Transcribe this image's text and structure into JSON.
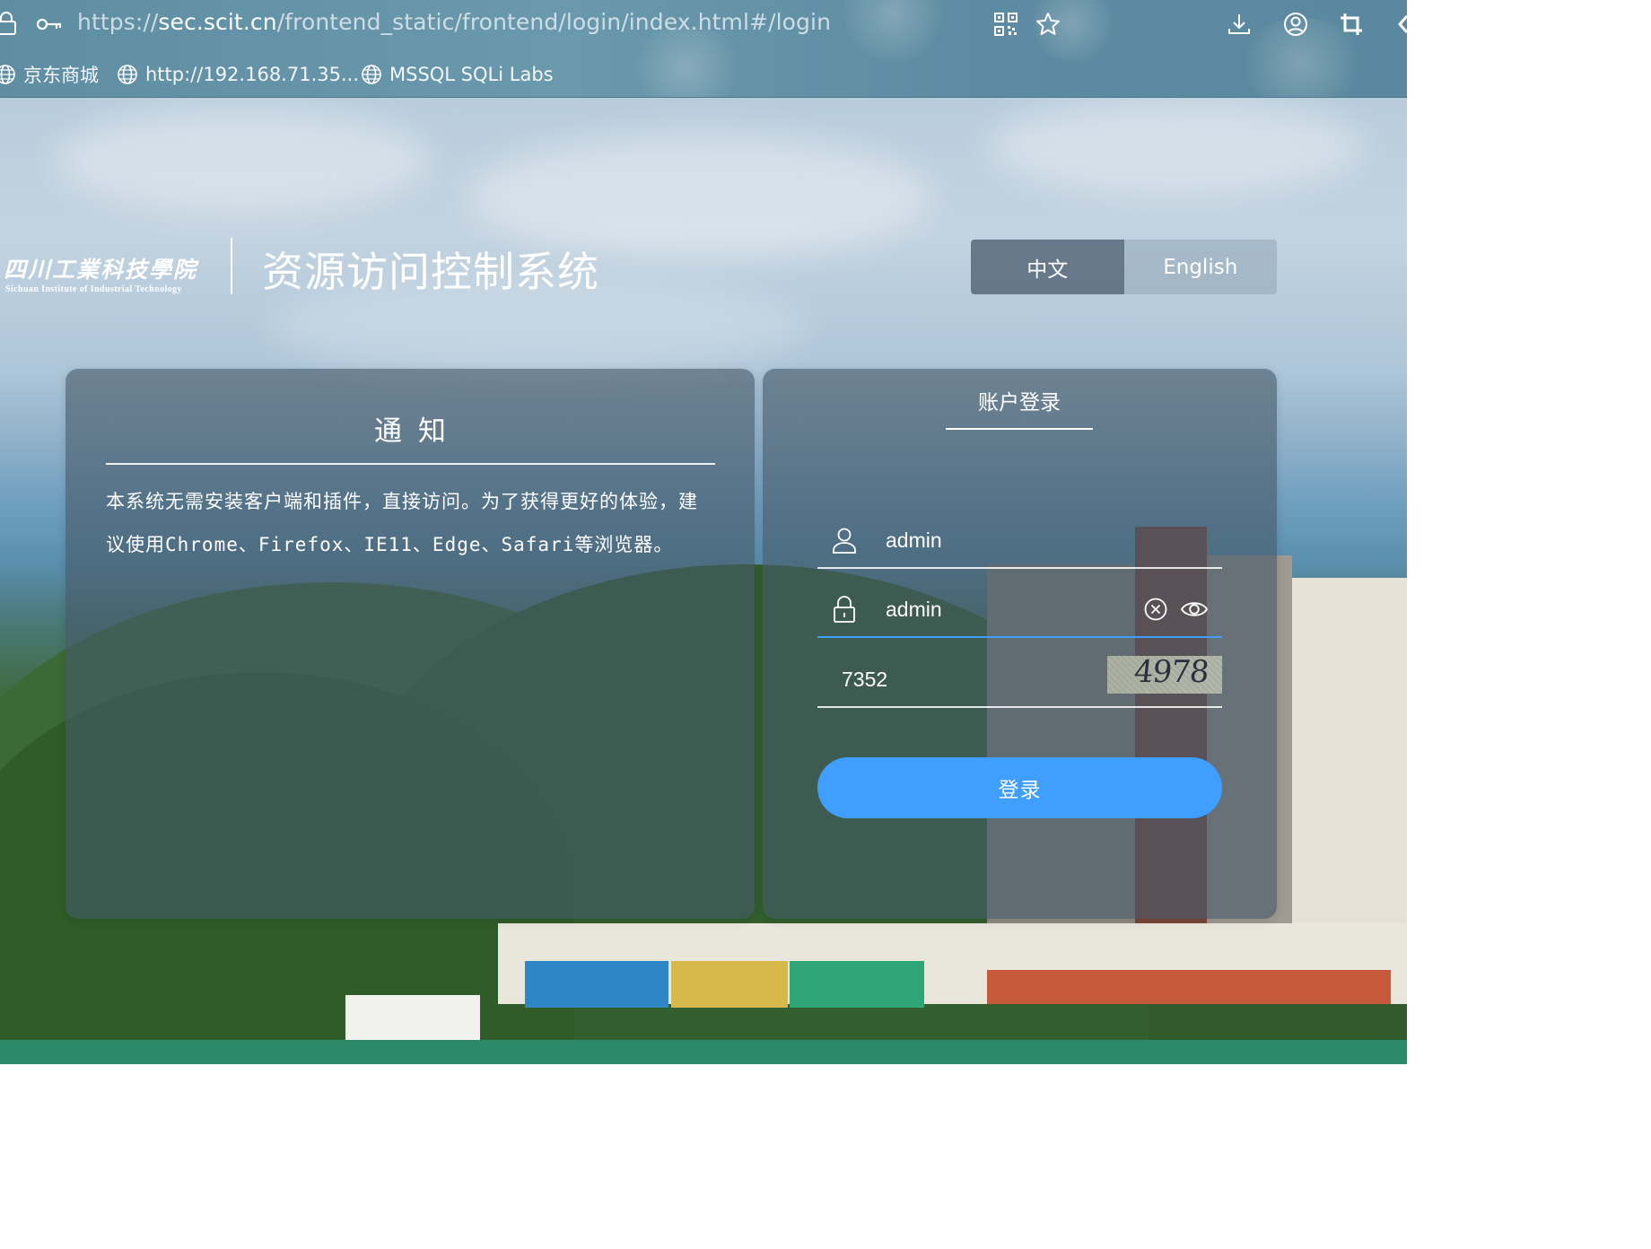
{
  "browser": {
    "url_scheme": "https://",
    "url_domain": "sec.scit.cn",
    "url_path": "/frontend_static/frontend/login/index.html#/login",
    "bookmarks": [
      {
        "label": "京东商城"
      },
      {
        "label": "http://192.168.71.35..."
      },
      {
        "label": "MSSQL SQLi Labs"
      }
    ],
    "toolbar_icons": [
      "qr-code-icon",
      "star-icon",
      "download-icon",
      "profile-icon",
      "crop-icon"
    ]
  },
  "header": {
    "logo_cn": "四川工業科技學院",
    "logo_en": "Sichuan Institute of Industrial Technology",
    "system_title": "资源访问控制系统",
    "lang_options": [
      "中文",
      "English"
    ],
    "active_lang": "中文"
  },
  "notice": {
    "title": "通知",
    "body": "本系统无需安装客户端和插件，直接访问。为了获得更好的体验，建议使用Chrome、Firefox、IE11、Edge、Safari等浏览器。"
  },
  "login": {
    "tab_label": "账户登录",
    "username": "admin",
    "password": "admin",
    "captcha_input": "7352",
    "captcha_image_text": "4978",
    "submit_label": "登录"
  },
  "colors": {
    "primary": "#409eff",
    "panel_bg": "rgba(70,88,104,0.62)",
    "chrome_bg": "#6a98ac"
  }
}
